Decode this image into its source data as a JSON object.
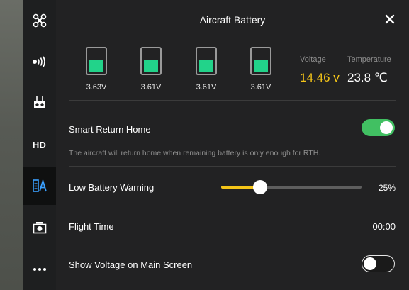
{
  "title": "Aircraft Battery",
  "sidebar": {
    "items": [
      {
        "icon": "aircraft-icon"
      },
      {
        "icon": "signal-icon"
      },
      {
        "icon": "remote-controller-icon"
      },
      {
        "label": "HD"
      },
      {
        "icon": "battery-icon",
        "active": true
      },
      {
        "icon": "camera-icon"
      },
      {
        "icon": "more-icon"
      }
    ]
  },
  "cells": [
    {
      "voltage": "3.63V",
      "level": 0.45
    },
    {
      "voltage": "3.61V",
      "level": 0.45
    },
    {
      "voltage": "3.61V",
      "level": 0.45
    },
    {
      "voltage": "3.61V",
      "level": 0.45
    }
  ],
  "stats": {
    "voltage_label": "Voltage",
    "voltage_value": "14.46 v",
    "temperature_label": "Temperature",
    "temperature_value": "23.8 ℃"
  },
  "settings": {
    "smart_rth": {
      "label": "Smart Return Home",
      "enabled": true,
      "description": "The aircraft will return home when remaining battery is only enough for RTH."
    },
    "low_battery": {
      "label": "Low Battery Warning",
      "value": "25%",
      "fraction": 0.28
    },
    "flight_time": {
      "label": "Flight Time",
      "value": "00:00"
    },
    "show_voltage": {
      "label": "Show Voltage on Main Screen",
      "enabled": false
    }
  },
  "colors": {
    "accent": "#f5c518",
    "cell_fill": "#22d38a",
    "toggle_on": "#41c062"
  }
}
